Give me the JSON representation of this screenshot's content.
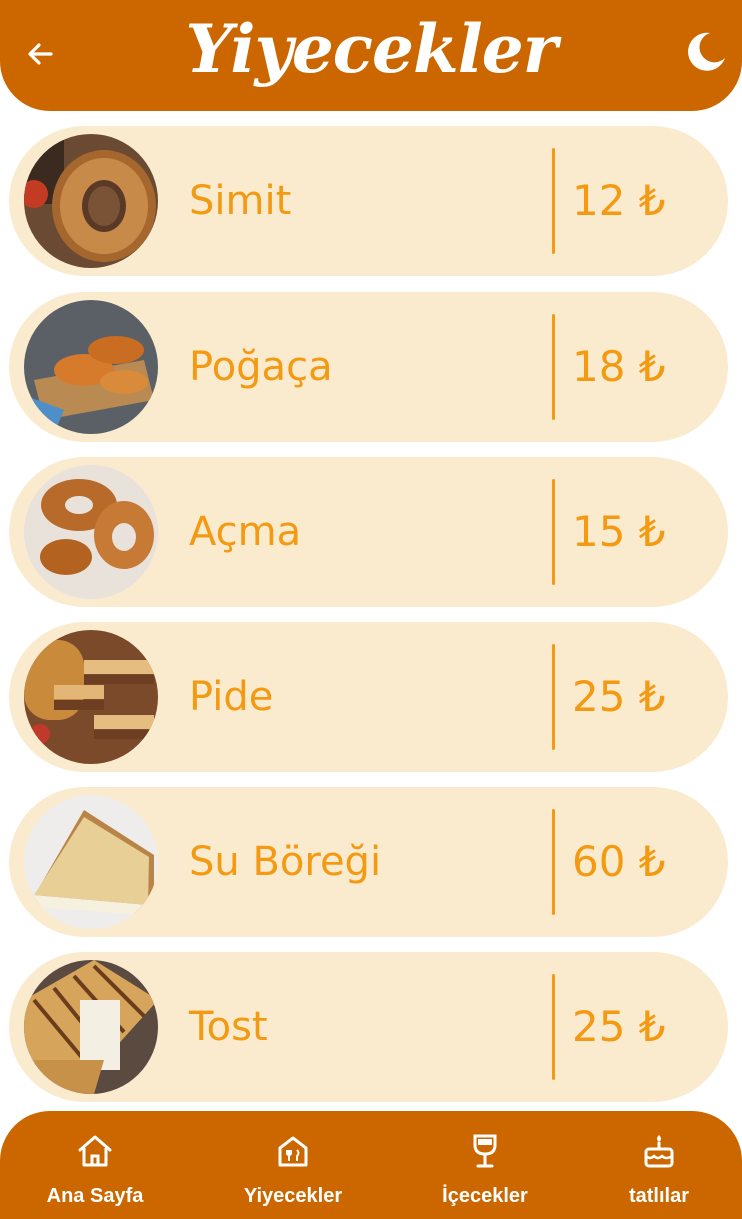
{
  "header": {
    "title": "Yiyecekler",
    "back_icon": "arrow-left-icon",
    "theme_icon": "moon-icon"
  },
  "colors": {
    "brand": "#cc6700",
    "card": "#faebcf",
    "accent": "#f39a12",
    "white": "#ffffff"
  },
  "items": [
    {
      "name": "Simit",
      "price": "12 ₺",
      "image": "simit-image"
    },
    {
      "name": "Poğaça",
      "price": "18 ₺",
      "image": "pogaca-image"
    },
    {
      "name": "Açma",
      "price": "15 ₺",
      "image": "acma-image"
    },
    {
      "name": "Pide",
      "price": "25 ₺",
      "image": "pide-image"
    },
    {
      "name": "Su Böreği",
      "price": "60 ₺",
      "image": "su-boregi-image"
    },
    {
      "name": "Tost",
      "price": "25 ₺",
      "image": "tost-image"
    }
  ],
  "nav": [
    {
      "label": "Ana Sayfa",
      "icon": "home-icon"
    },
    {
      "label": "Yiyecekler",
      "icon": "food-icon"
    },
    {
      "label": "İçecekler",
      "icon": "drink-icon"
    },
    {
      "label": "tatlılar",
      "icon": "cake-icon"
    }
  ]
}
